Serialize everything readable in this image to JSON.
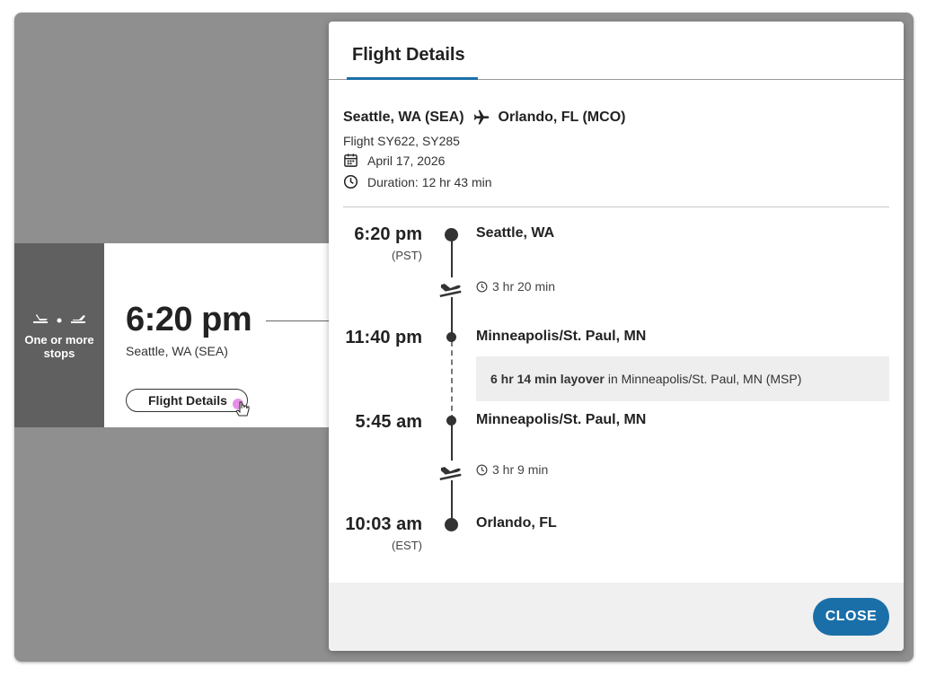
{
  "background": {
    "stops_label": "One or more stops",
    "departure_time": "6:20 pm",
    "departure_city": "Seattle, WA (SEA)",
    "flight_details_button": "Flight Details"
  },
  "modal": {
    "tab_title": "Flight Details",
    "origin": "Seattle, WA (SEA)",
    "destination": "Orlando, FL (MCO)",
    "flight_numbers": "Flight SY622, SY285",
    "date": "April 17, 2026",
    "duration": "Duration: 12 hr 43 min",
    "timeline": {
      "stop1": {
        "time": "6:20 pm",
        "tz": "(PST)",
        "city": "Seattle, WA"
      },
      "leg1_duration": "3 hr 20 min",
      "stop2": {
        "time": "11:40 pm",
        "city": "Minneapolis/St. Paul, MN"
      },
      "layover": {
        "bold": "6 hr 14 min layover",
        "rest": "in Minneapolis/St. Paul, MN (MSP)"
      },
      "stop3": {
        "time": "5:45 am",
        "city": "Minneapolis/St. Paul, MN"
      },
      "leg2_duration": "3 hr 9 min",
      "stop4": {
        "time": "10:03 am",
        "tz": "(EST)",
        "city": "Orlando, FL"
      }
    },
    "close_button": "CLOSE"
  },
  "colors": {
    "accent": "#1a6fa8",
    "overlay": "#8f8f8f",
    "stops_panel": "#606060"
  }
}
